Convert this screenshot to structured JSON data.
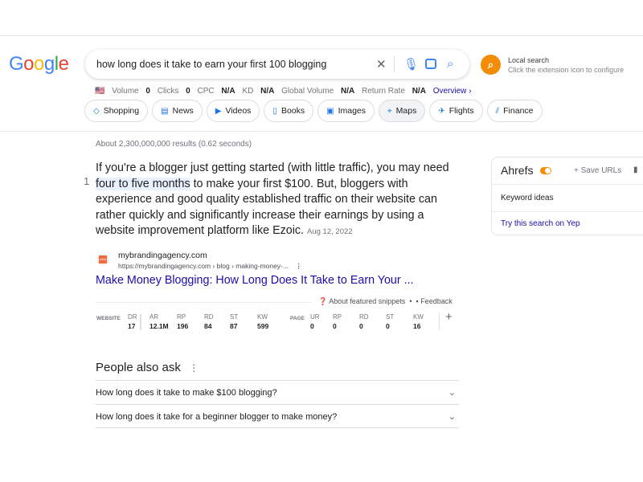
{
  "logo": "Google",
  "search": {
    "query": "how long does it take to earn your first 100 blogging"
  },
  "local": {
    "title": "Local search",
    "subtitle": "Click the extension icon to configure"
  },
  "stats": [
    {
      "label": "Volume",
      "value": "0"
    },
    {
      "label": "Clicks",
      "value": "0"
    },
    {
      "label": "CPC",
      "value": "N/A"
    },
    {
      "label": "KD",
      "value": "N/A"
    },
    {
      "label": "Global Volume",
      "value": "N/A"
    },
    {
      "label": "Return Rate",
      "value": "N/A"
    }
  ],
  "overview": "Overview ›",
  "chips": [
    {
      "label": "Shopping",
      "icon": "◇"
    },
    {
      "label": "News",
      "icon": "▤"
    },
    {
      "label": "Videos",
      "icon": "▶"
    },
    {
      "label": "Books",
      "icon": "▯"
    },
    {
      "label": "Images",
      "icon": "▣"
    },
    {
      "label": "Maps",
      "icon": "⌖"
    },
    {
      "label": "Flights",
      "icon": "✈"
    },
    {
      "label": "Finance",
      "icon": "⫽"
    }
  ],
  "results_count": "About 2,300,000,000 results (0.62 seconds)",
  "snippet": {
    "number": "1",
    "before": "If you're a blogger just getting started (with little traffic), you may need ",
    "highlight": "four to five months",
    "after": " to make your first $100. But, bloggers with experience and good quality established traffic on their website can rather quickly and significantly increase their earnings by using a website improvement platform like Ezoic.",
    "date": "Aug 12, 2022"
  },
  "result": {
    "site": "mybrandingagency.com",
    "url": "https://mybrandingagency.com › blog › making-money-...",
    "title": "Make Money Blogging: How Long Does It Take to Earn Your ...",
    "favicon_text": "mba"
  },
  "about_snippets": "About featured snippets",
  "feedback": "Feedback",
  "metrics": {
    "website_label": "WEBSITE",
    "page_label": "PAGE",
    "website": [
      {
        "k": "DR",
        "v": "17"
      },
      {
        "k": "AR",
        "v": "12.1M"
      },
      {
        "k": "RP",
        "v": "196"
      },
      {
        "k": "RD",
        "v": "84"
      },
      {
        "k": "ST",
        "v": "87"
      },
      {
        "k": "KW",
        "v": "599"
      }
    ],
    "page": [
      {
        "k": "UR",
        "v": "0"
      },
      {
        "k": "RP",
        "v": "0"
      },
      {
        "k": "RD",
        "v": "0"
      },
      {
        "k": "ST",
        "v": "0"
      },
      {
        "k": "KW",
        "v": "16"
      }
    ]
  },
  "paa": {
    "title": "People also ask",
    "questions": [
      "How long does it take to make $100 blogging?",
      "How long does it take for a beginner blogger to make money?"
    ]
  },
  "ahrefs": {
    "title": "Ahrefs",
    "save": "+ Save URLs",
    "keyword_ideas": "Keyword ideas",
    "yep": "Try this search on Yep",
    "accent": "#f48c06"
  }
}
